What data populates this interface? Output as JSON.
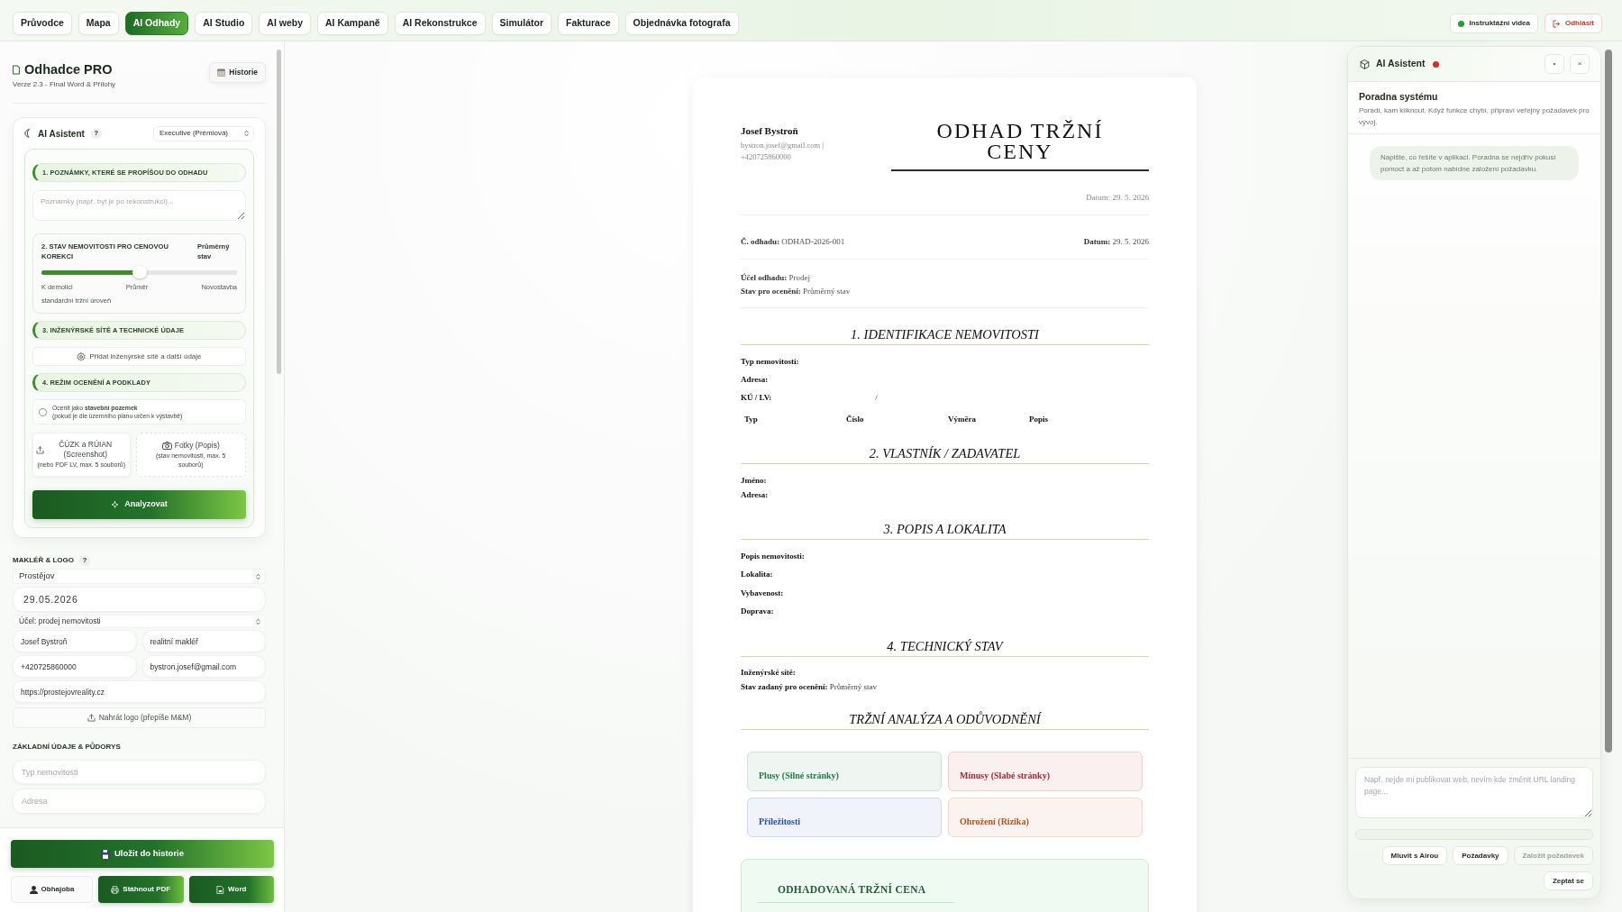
{
  "topbar": {
    "tabs": [
      {
        "label": "Průvodce",
        "selected": false
      },
      {
        "label": "Mapa",
        "selected": false
      },
      {
        "label": "AI Odhady",
        "selected": true
      },
      {
        "label": "AI Studio",
        "selected": false
      },
      {
        "label": "AI weby",
        "selected": false
      },
      {
        "label": "AI Kampaně",
        "selected": false
      },
      {
        "label": "AI Rekonstrukce",
        "selected": false
      },
      {
        "label": "Simulátor",
        "selected": false
      },
      {
        "label": "Fakturace",
        "selected": false
      },
      {
        "label": "Objednávka fotografa",
        "selected": false
      }
    ],
    "actions": [
      {
        "kind": "video",
        "label": "Instruktážní videa"
      },
      {
        "kind": "logout",
        "label": "Odhlásit"
      }
    ]
  },
  "sidebar": {
    "title": "Odhadce PRO",
    "version": "Verze 2.3 - Final Word & Přílohy",
    "history_button": "Historie",
    "assistant": {
      "title": "AI Asistent",
      "help": "?",
      "mode": "Executive (Prémiová)",
      "notes": {
        "heading": "1. POZNÁMKY, KTERÉ SE PROPÍŠOU DO ODHADU",
        "placeholder": "Poznámky (např. byt je po rekonstrukci)..."
      },
      "condition": {
        "heading": "2. STAV NEMOVITOSTI PRO CENOVOU KOREKCI",
        "value": "Průměrný stav",
        "level": 0.5,
        "scale": [
          "K demolici",
          "Průměr",
          "Novostavba"
        ],
        "note": "standardní tržní úroveň"
      },
      "utilities": {
        "heading": "3. INŽENÝRSKÉ SÍTĚ A TECHNICKÉ ÚDAJE",
        "button": "Přidat inženýrské sítě a další údaje"
      },
      "valuation": {
        "heading": "4. REŽIM OCENĚNÍ A PODKLADY",
        "checkbox": {
          "label": "Ocenit jako **stavební pozemek**",
          "hint": "(pokud je dle územního plánu určen k výstavbě)",
          "checked": false
        },
        "uploads": [
          {
            "kind": "document",
            "title": "ČÚZK a RÚIAN (Screenshot)",
            "hint": "(nebo PDF LV, max. 5 souborů)"
          },
          {
            "kind": "photo",
            "title": "Fotky (Popis)",
            "hint": "(stav nemovitosti, max. 5 souborů)"
          }
        ]
      },
      "analyze_button": "Analyzovat"
    },
    "broker": {
      "heading": "MAKLÉŘ & LOGO",
      "help": "?",
      "city": "Prostějov",
      "date": "29.05.2026",
      "purpose": "Účel: prodej nemovitosti",
      "name": "Josef Bystroň",
      "role": "realitní makléř",
      "phone": "+420725860000",
      "email": "bystron.josef@gmail.com",
      "web": "https://prostejovreality.cz",
      "logo_button": "Nahrát logo (přepíše M&M)"
    },
    "basics": {
      "heading": "ZÁKLADNÍ ÚDAJE & PŮDORYS",
      "fields": [
        {
          "placeholder": "Typ nemovitosti"
        },
        {
          "placeholder": "Adresa"
        }
      ]
    },
    "footer": {
      "save_button": "Uložit do historie",
      "buttons": [
        {
          "kind": "defense",
          "label": "Obhajoba"
        },
        {
          "kind": "pdf",
          "label": "Stáhnout PDF"
        },
        {
          "kind": "word",
          "label": "Word"
        }
      ]
    }
  },
  "document": {
    "author": "Josef Bystroň",
    "contact": "bystron.josef@gmail.com | +420725860000",
    "title": "ODHAD TRŽNÍ CENY",
    "date_line": "Datum: 29. 5. 2026",
    "meta": [
      {
        "label": "Č. odhadu:",
        "value": "ODHAD-2026-001"
      },
      {
        "label": "Datum:",
        "value": "29. 5. 2026"
      }
    ],
    "purpose": [
      {
        "label": "Účel odhadu:",
        "value": "Prodej"
      },
      {
        "label": "Stav pro ocenění:",
        "value": "Průměrný stav"
      }
    ],
    "sections": [
      {
        "kind": "spaced",
        "heading": "1. IDENTIFIKACE NEMOVITOSTI",
        "fields": [
          {
            "label": "Typ nemovitosti:"
          },
          {
            "label": "Adresa:"
          }
        ],
        "cadastre": {
          "label": "KÚ / LV:",
          "separator": "/"
        },
        "table_columns": [
          "Typ",
          "Číslo",
          "Výměra",
          "Popis"
        ]
      },
      {
        "kind": "compact",
        "heading": "2. VLASTNÍK / ZADAVATEL",
        "fields": [
          {
            "label": "Jméno:"
          },
          {
            "label": "Adresa:"
          }
        ]
      },
      {
        "kind": "spaced",
        "heading": "3. POPIS A LOKALITA",
        "fields": [
          {
            "label": "Popis nemovitosti:"
          },
          {
            "label": "Lokalita:"
          },
          {
            "label": "Vybavenost:"
          },
          {
            "label": "Doprava:"
          }
        ]
      },
      {
        "kind": "compact",
        "heading": "4. TECHNICKÝ STAV",
        "fields": [
          {
            "label": "Inženýrské sítě:"
          },
          {
            "label": "Stav zadaný pro ocenění:",
            "value": "Průměrný stav"
          }
        ]
      },
      {
        "kind": "analysis",
        "heading": "TRŽNÍ ANALÝZA A ODŮVODNĚNÍ",
        "swot": [
          {
            "title": "Plusy (Silné stránky)",
            "color": "#1e7d45"
          },
          {
            "title": "Mínusy (Slabé stránky)",
            "color": "#b3262f"
          },
          {
            "title": "Příležitosti",
            "color": "#2450b8"
          },
          {
            "title": "Ohrožení (Rizika)",
            "color": "#b5531c"
          }
        ]
      }
    ],
    "price": {
      "heading": "ODHADOVANÁ TRŽNÍ CENA"
    }
  },
  "assistant_panel": {
    "title": "AI Asistent",
    "controls": [
      "•",
      "×"
    ],
    "heading": "Poradna systému",
    "subtitle": "Poradí, kam kliknout. Když funkce chybí, připraví veřejný požadavek pro vývoj.",
    "messages": [
      {
        "text": "Napište, co řešíte v aplikaci. Poradna se nejdřív pokusí pomoct a až potom nabídne založení požadavku."
      }
    ],
    "input": {
      "placeholder": "Např. nejde mi publikovat web, nevím kde změnit URL landing page..."
    },
    "buttons": [
      {
        "label": "Mluvit s Airou",
        "disabled": false
      },
      {
        "label": "Požadavky",
        "disabled": false
      },
      {
        "label": "Založit požadavek",
        "disabled": true
      }
    ],
    "send_button": "Zeptat se"
  }
}
